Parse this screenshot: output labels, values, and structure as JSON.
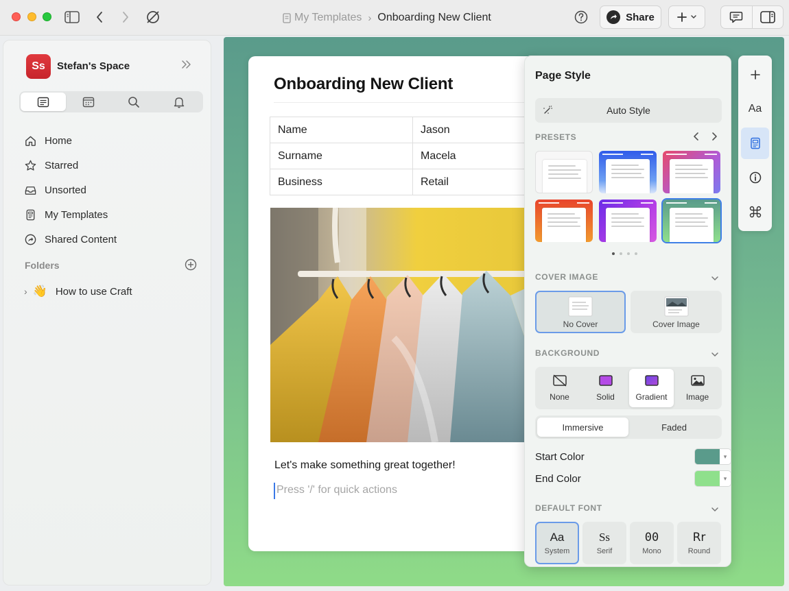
{
  "titlebar": {
    "breadcrumb_parent": "My Templates",
    "breadcrumb_current": "Onboarding New Client",
    "share_label": "Share"
  },
  "sidebar": {
    "space_initials": "Ss",
    "space_name": "Stefan's Space",
    "nav": [
      {
        "label": "Home",
        "icon": "home-icon"
      },
      {
        "label": "Starred",
        "icon": "star-icon"
      },
      {
        "label": "Unsorted",
        "icon": "inbox-icon"
      },
      {
        "label": "My Templates",
        "icon": "template-icon"
      },
      {
        "label": "Shared Content",
        "icon": "shared-icon"
      }
    ],
    "folders_label": "Folders",
    "folder_items": [
      {
        "emoji": "👋",
        "label": "How to use Craft"
      }
    ]
  },
  "document": {
    "title": "Onboarding New Client",
    "table": [
      [
        "Name",
        "Jason"
      ],
      [
        "Surname",
        "Macela"
      ],
      [
        "Business",
        "Retail"
      ]
    ],
    "image_alt": "clothing rack with jackets",
    "body_text": "Let's make something great together!",
    "placeholder": "Press '/' for quick actions"
  },
  "panel": {
    "title": "Page Style",
    "auto_style": "Auto Style",
    "presets_label": "PRESETS",
    "cover_label": "COVER IMAGE",
    "cover_options": [
      "No Cover",
      "Cover Image"
    ],
    "background_label": "BACKGROUND",
    "background_options": [
      "None",
      "Solid",
      "Gradient",
      "Image"
    ],
    "mode_options": [
      "Immersive",
      "Faded"
    ],
    "start_color_label": "Start Color",
    "end_color_label": "End Color",
    "start_color": "#5a9b8b",
    "end_color": "#8fe08c",
    "font_label": "DEFAULT FONT",
    "fonts": [
      {
        "glyph": "Aa",
        "name": "System"
      },
      {
        "glyph": "Ss",
        "name": "Serif"
      },
      {
        "glyph": "00",
        "name": "Mono"
      },
      {
        "glyph": "Rr",
        "name": "Round"
      }
    ]
  },
  "rail": {
    "text_style": "Aa"
  }
}
